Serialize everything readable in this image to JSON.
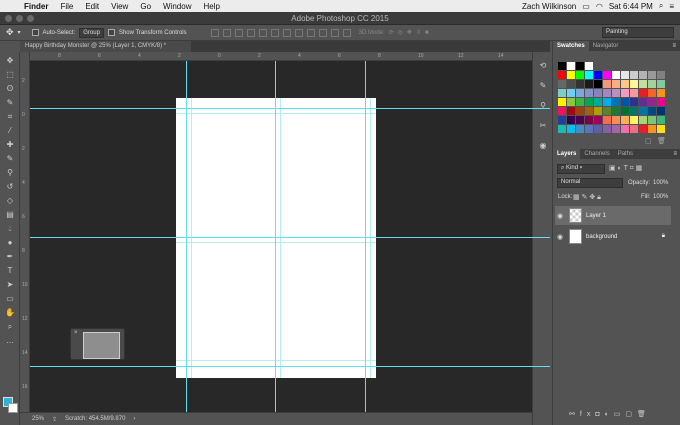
{
  "menubar": {
    "app": "Finder",
    "items": [
      "File",
      "Edit",
      "View",
      "Go",
      "Window",
      "Help"
    ],
    "user": "Zach Wilkinson",
    "clock": "Sat 6:44 PM"
  },
  "window": {
    "title": "Adobe Photoshop CC 2015"
  },
  "options": {
    "auto_select_label": "Auto-Select:",
    "auto_select_value": "Group",
    "transform_label": "Show Transform Controls",
    "mode_3d": "3D Mode:",
    "workspace": "Painting"
  },
  "document": {
    "tab_label": "Happy Birthday Monster @ 25% (Layer 1, CMYK/8) *"
  },
  "rulers": {
    "h": [
      "8",
      "6",
      "4",
      "2",
      "0",
      "2",
      "4",
      "6",
      "8",
      "10",
      "12",
      "14",
      "16"
    ],
    "v": [
      "2",
      "0",
      "2",
      "4",
      "6",
      "8",
      "10",
      "12",
      "14",
      "16",
      "18"
    ]
  },
  "status": {
    "zoom": "25%",
    "scratch": "Scratch: 454.5M/9.870"
  },
  "swatches_panel": {
    "tabs": [
      "Swatches",
      "Navigator"
    ],
    "colors": [
      [
        "#000000",
        "#ffffff",
        "#000000",
        "#ffffff"
      ],
      [
        "#ff0000",
        "#ffff00",
        "#00ff00",
        "#00ffff",
        "#0000ff",
        "#ff00ff",
        "#ffffff",
        "#e6e6e6",
        "#cccccc",
        "#b3b3b3",
        "#999999",
        "#808080"
      ],
      [
        "#666666",
        "#4d4d4d",
        "#333333",
        "#1a1a1a",
        "#000000",
        "#f7977a",
        "#f9ad81",
        "#fdc68a",
        "#fff79a",
        "#c4df9b",
        "#a2d39c",
        "#82ca9d"
      ],
      [
        "#7bcdc8",
        "#6ecff6",
        "#7ea7d8",
        "#8493ca",
        "#8882be",
        "#a187be",
        "#bc8dbf",
        "#f49ac2",
        "#f6989d",
        "#ed1c24",
        "#f26522",
        "#f7941d"
      ],
      [
        "#fff200",
        "#8dc63f",
        "#39b54a",
        "#00a651",
        "#00a99d",
        "#00aeef",
        "#0072bc",
        "#0054a6",
        "#2e3192",
        "#662d91",
        "#92278f",
        "#ec008c"
      ],
      [
        "#ed145b",
        "#9e0b0f",
        "#a0410d",
        "#a36209",
        "#aba000",
        "#598527",
        "#197b30",
        "#007236",
        "#00746b",
        "#0076a3",
        "#004a80",
        "#003471"
      ],
      [
        "#21409a",
        "#32004b",
        "#4b0049",
        "#7b0046",
        "#9e005d",
        "#f26c4f",
        "#f68e55",
        "#fbaf5c",
        "#fff467",
        "#acd372",
        "#7cc576",
        "#3bb878"
      ],
      [
        "#1abbb4",
        "#00bff3",
        "#438ccb",
        "#5574b9",
        "#605ca8",
        "#855fa8",
        "#a763a8",
        "#f06ea9",
        "#f26d7d",
        "#ed1c24",
        "#f7941d",
        "#ffde17"
      ]
    ]
  },
  "layers_panel": {
    "tabs": [
      "Layers",
      "Channels",
      "Paths"
    ],
    "filter": "Kind",
    "blend_mode": "Normal",
    "opacity_label": "Opacity:",
    "opacity": "100%",
    "lock_label": "Lock:",
    "fill_label": "Fill:",
    "fill": "100%",
    "layers": [
      {
        "name": "Layer 1",
        "selected": true
      },
      {
        "name": "background",
        "locked": true
      }
    ]
  },
  "colors": {
    "guide": "#5ee0f0",
    "canvas_bg": "#282828",
    "fg_swatch": "#29b4e0",
    "bg_swatch": "#ffffff"
  }
}
